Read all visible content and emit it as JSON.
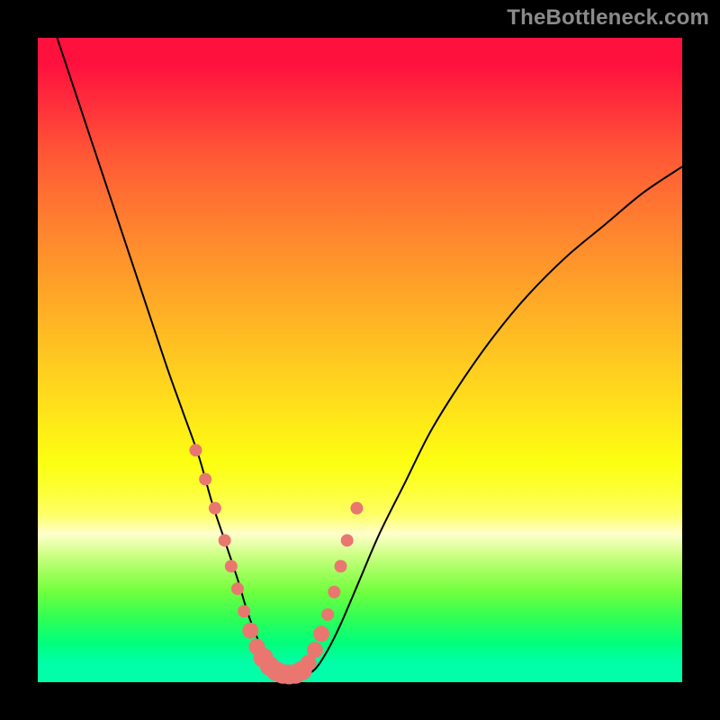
{
  "watermark": "TheBottleneck.com",
  "chart_data": {
    "type": "line",
    "title": "",
    "xlabel": "",
    "ylabel": "",
    "xlim": [
      0,
      100
    ],
    "ylim": [
      0,
      100
    ],
    "note": "Axes are implicit (no ticks shown); values are percentages of the plot area.",
    "series": [
      {
        "name": "bottleneck-curve",
        "x": [
          3,
          5,
          8,
          11,
          14,
          17,
          20,
          22.5,
          25,
          27,
          29,
          31,
          32.5,
          34,
          35.5,
          37,
          39,
          41,
          43,
          45,
          47,
          50,
          53,
          57,
          61,
          66,
          71,
          76,
          82,
          88,
          94,
          100
        ],
        "y": [
          100,
          94,
          85,
          76,
          67,
          58,
          49,
          42,
          35,
          28,
          22,
          16,
          11,
          7,
          4,
          2,
          1,
          1,
          2,
          5,
          9,
          16,
          23,
          31,
          39,
          47,
          54,
          60,
          66,
          71,
          76,
          80
        ]
      }
    ],
    "markers": {
      "name": "highlighted-dots",
      "color": "#e97770",
      "x": [
        24.5,
        26,
        27.5,
        29,
        30,
        31,
        32,
        33,
        34,
        35,
        36,
        37,
        38,
        39,
        40,
        41,
        42,
        43,
        44,
        45,
        46,
        47,
        48,
        49.5
      ],
      "y": [
        36,
        31.5,
        27,
        22,
        18,
        14.5,
        11,
        8,
        5.5,
        3.8,
        2.5,
        1.7,
        1.3,
        1.2,
        1.3,
        1.8,
        3,
        5,
        7.5,
        10.5,
        14,
        18,
        22,
        27
      ],
      "r": [
        7,
        7,
        7,
        7,
        7,
        7,
        7,
        9,
        9,
        11,
        11,
        11,
        11,
        11,
        11,
        11,
        9,
        9,
        9,
        7,
        7,
        7,
        7,
        7
      ]
    }
  },
  "colors": {
    "marker": "#e97770",
    "curve": "#000000",
    "frame": "#000000",
    "watermark": "#8a8a8a"
  }
}
